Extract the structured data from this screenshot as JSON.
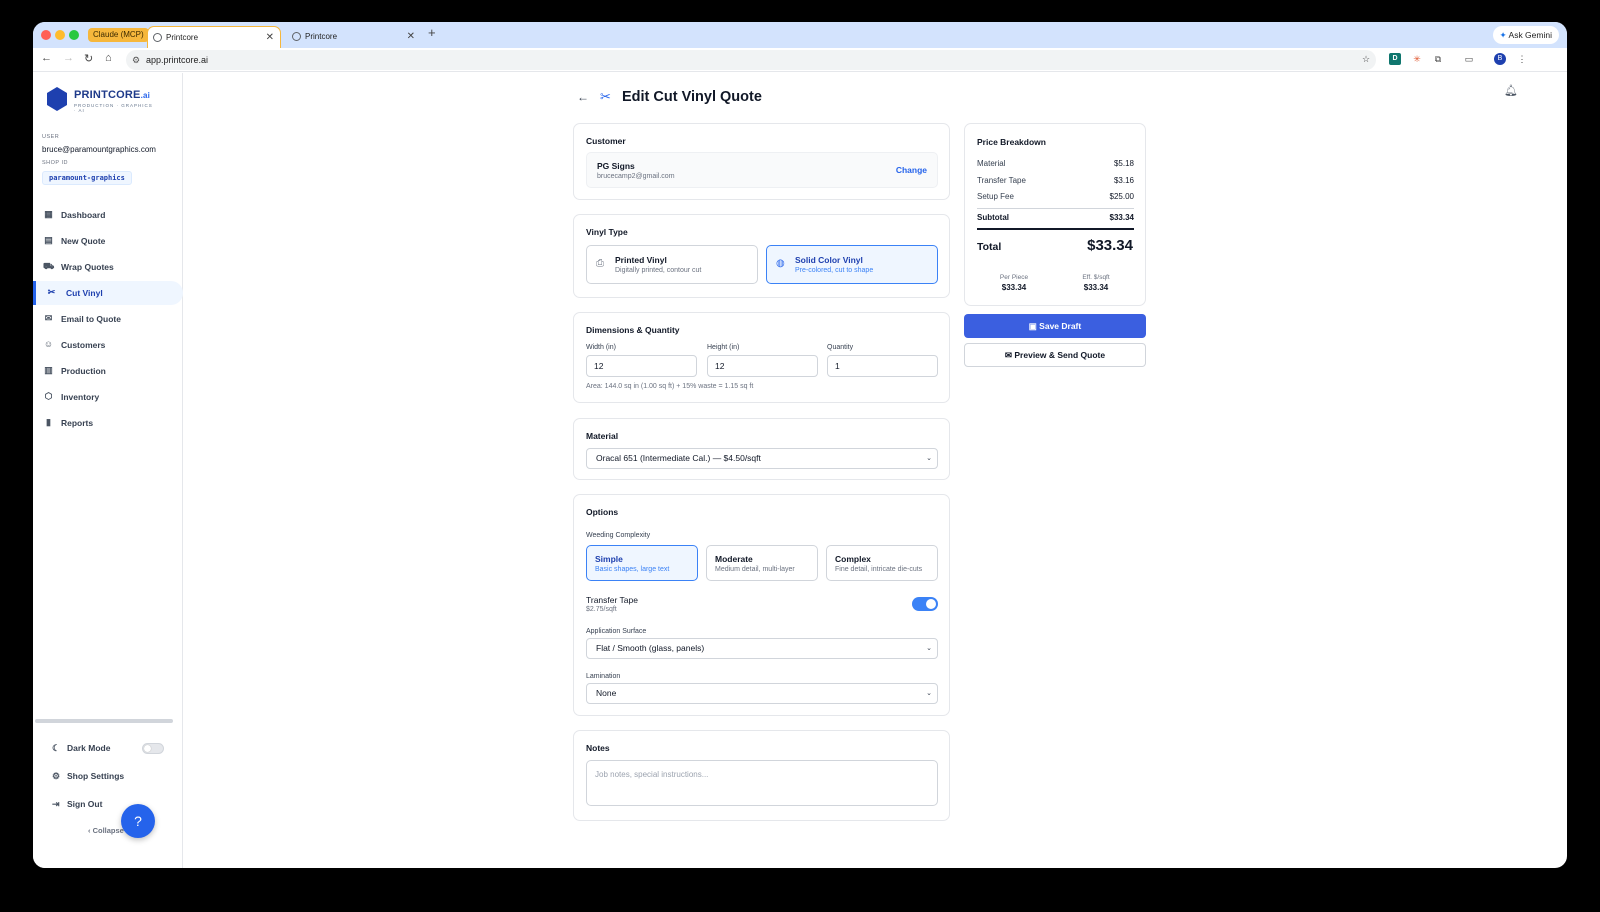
{
  "browser": {
    "group_chip": "Claude (MCP)",
    "tabs": [
      {
        "label": "Printcore"
      },
      {
        "label": "Printcore"
      }
    ],
    "gemini_label": "Ask Gemini",
    "url": "app.printcore.ai",
    "profile_initial": "B"
  },
  "sidebar": {
    "logo_word": "PRINTCORE",
    "logo_suffix": ".ai",
    "logo_tagline": "PRODUCTION · GRAPHICS · AI",
    "user_label": "USER",
    "user_email": "bruce@paramountgraphics.com",
    "shop_label": "SHOP ID",
    "shop_id": "paramount-graphics",
    "items": [
      {
        "label": "Dashboard",
        "icon": "grid-icon"
      },
      {
        "label": "New Quote",
        "icon": "file-icon"
      },
      {
        "label": "Wrap Quotes",
        "icon": "car-icon"
      },
      {
        "label": "Cut Vinyl",
        "icon": "scissors-icon",
        "active": true
      },
      {
        "label": "Email to Quote",
        "icon": "mail-icon"
      },
      {
        "label": "Customers",
        "icon": "users-icon"
      },
      {
        "label": "Production",
        "icon": "factory-icon"
      },
      {
        "label": "Inventory",
        "icon": "box-icon"
      },
      {
        "label": "Reports",
        "icon": "bar-chart-icon"
      }
    ],
    "dark_mode": "Dark Mode",
    "shop_settings": "Shop Settings",
    "sign_out": "Sign Out",
    "collapse": "Collapse"
  },
  "page": {
    "title": "Edit Cut Vinyl Quote"
  },
  "customer": {
    "section": "Customer",
    "name": "PG Signs",
    "email": "brucecamp2@gmail.com",
    "change": "Change"
  },
  "vinyl_type": {
    "section": "Vinyl Type",
    "options": [
      {
        "title": "Printed Vinyl",
        "sub": "Digitally printed, contour cut",
        "selected": false
      },
      {
        "title": "Solid Color Vinyl",
        "sub": "Pre-colored, cut to shape",
        "selected": true
      }
    ]
  },
  "dimensions": {
    "section": "Dimensions & Quantity",
    "width_label": "Width (in)",
    "width": "12",
    "height_label": "Height (in)",
    "height": "12",
    "qty_label": "Quantity",
    "qty": "1",
    "area_hint": "Area: 144.0 sq in (1.00 sq ft)  + 15% waste = 1.15 sq ft"
  },
  "material": {
    "section": "Material",
    "selected": "Oracal 651 (Intermediate Cal.) — $4.50/sqft"
  },
  "options": {
    "section": "Options",
    "weeding_label": "Weeding Complexity",
    "weeding": [
      {
        "title": "Simple",
        "sub": "Basic shapes, large text",
        "selected": true
      },
      {
        "title": "Moderate",
        "sub": "Medium detail, multi-layer",
        "selected": false
      },
      {
        "title": "Complex",
        "sub": "Fine detail, intricate die-cuts",
        "selected": false
      }
    ],
    "transfer_tape_label": "Transfer Tape",
    "transfer_tape_price": "$2.75/sqft",
    "transfer_tape_on": true,
    "surface_label": "Application Surface",
    "surface": "Flat / Smooth (glass, panels)",
    "lamination_label": "Lamination",
    "lamination": "None"
  },
  "notes": {
    "section": "Notes",
    "placeholder": "Job notes, special instructions..."
  },
  "price": {
    "title": "Price Breakdown",
    "rows": [
      {
        "label": "Material",
        "value": "$5.18"
      },
      {
        "label": "Transfer Tape",
        "value": "$3.16"
      },
      {
        "label": "Setup Fee",
        "value": "$25.00"
      }
    ],
    "subtotal_label": "Subtotal",
    "subtotal": "$33.34",
    "total_label": "Total",
    "total": "$33.34",
    "per_piece_label": "Per Piece",
    "per_piece": "$33.34",
    "eff_label": "Eff. $/sqft",
    "eff": "$33.34"
  },
  "actions": {
    "save_draft": "Save Draft",
    "preview_send": "Preview & Send Quote"
  },
  "colors": {
    "accent": "#2563eb",
    "save_button": "#3b5fe0"
  }
}
